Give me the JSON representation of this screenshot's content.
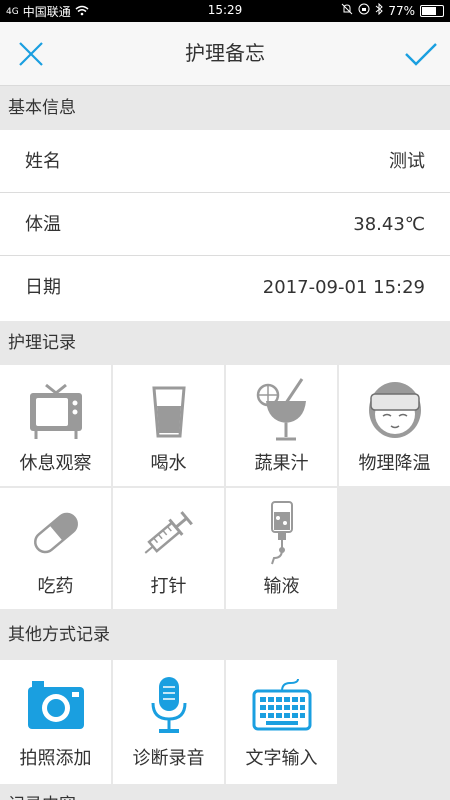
{
  "status_bar": {
    "carrier": "中国联通",
    "signal": "4G",
    "time": "15:29",
    "battery": "77%",
    "battery_level": 0.77
  },
  "header": {
    "title": "护理备忘"
  },
  "basic_info": {
    "title": "基本信息",
    "rows": [
      {
        "label": "姓名",
        "value": "测试"
      },
      {
        "label": "体温",
        "value": "38.43℃"
      },
      {
        "label": "日期",
        "value": "2017-09-01 15:29"
      }
    ]
  },
  "care_records": {
    "title": "护理记录",
    "items": [
      {
        "label": "休息观察",
        "icon": "tv-icon"
      },
      {
        "label": "喝水",
        "icon": "water-glass-icon"
      },
      {
        "label": "蔬果汁",
        "icon": "juice-icon"
      },
      {
        "label": "物理降温",
        "icon": "cooling-towel-icon"
      },
      {
        "label": "吃药",
        "icon": "pill-icon"
      },
      {
        "label": "打针",
        "icon": "syringe-icon"
      },
      {
        "label": "输液",
        "icon": "iv-drip-icon"
      }
    ]
  },
  "other_records": {
    "title": "其他方式记录",
    "items": [
      {
        "label": "拍照添加",
        "icon": "camera-icon"
      },
      {
        "label": "诊断录音",
        "icon": "microphone-icon"
      },
      {
        "label": "文字输入",
        "icon": "keyboard-icon"
      }
    ]
  },
  "colors": {
    "accent": "#1a9fe0",
    "icon_gray": "#9a9a9a",
    "background": "#e8e8e8"
  },
  "next_section": {
    "partial_title": "记录内容"
  }
}
